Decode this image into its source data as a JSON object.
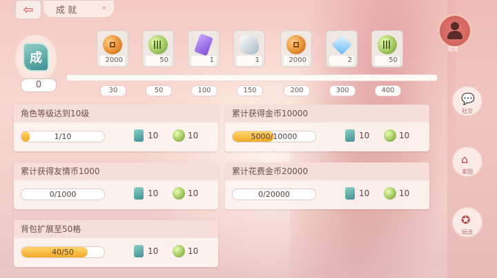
{
  "header": {
    "back_icon": "back-arrow-icon",
    "title": "成 就",
    "title_ornament": "✦"
  },
  "badge": {
    "glyph": "成",
    "count": "0"
  },
  "rewards": [
    {
      "type": "coin",
      "amount": "2000"
    },
    {
      "type": "jade",
      "amount": "50"
    },
    {
      "type": "crystal",
      "amount": "1"
    },
    {
      "type": "stone",
      "amount": "1"
    },
    {
      "type": "coin",
      "amount": "2000"
    },
    {
      "type": "diamond",
      "amount": "2"
    },
    {
      "type": "jade",
      "amount": "50"
    }
  ],
  "milestones": [
    "30",
    "50",
    "100",
    "150",
    "200",
    "300",
    "400"
  ],
  "tasks": [
    {
      "title": "角色等级达到10级",
      "progress_text": "1/10",
      "progress": 0.1,
      "reward1": "10",
      "reward2": "10"
    },
    {
      "title": "累计获得金币10000",
      "progress_text": "5000/10000",
      "progress": 0.5,
      "reward1": "10",
      "reward2": "10"
    },
    {
      "title": "累计获得友情币1000",
      "progress_text": "0/1000",
      "progress": 0.0,
      "reward1": "10",
      "reward2": "10"
    },
    {
      "title": "累计花费金币20000",
      "progress_text": "0/20000",
      "progress": 0.0,
      "reward1": "10",
      "reward2": "10"
    },
    {
      "title": "背包扩展至50格",
      "progress_text": "40/50",
      "progress": 0.8,
      "reward1": "10",
      "reward2": "10"
    }
  ],
  "side_menu": {
    "avatar_label": "成就",
    "items": [
      {
        "label": "社交",
        "icon": "chat-icon"
      },
      {
        "label": "家园",
        "icon": "house-icon"
      },
      {
        "label": "玩法",
        "icon": "gamepad-icon"
      }
    ]
  },
  "colors": {
    "accent": "#f2aa2a",
    "card_header": "#f6dad5",
    "background": "#f4c9c4"
  }
}
